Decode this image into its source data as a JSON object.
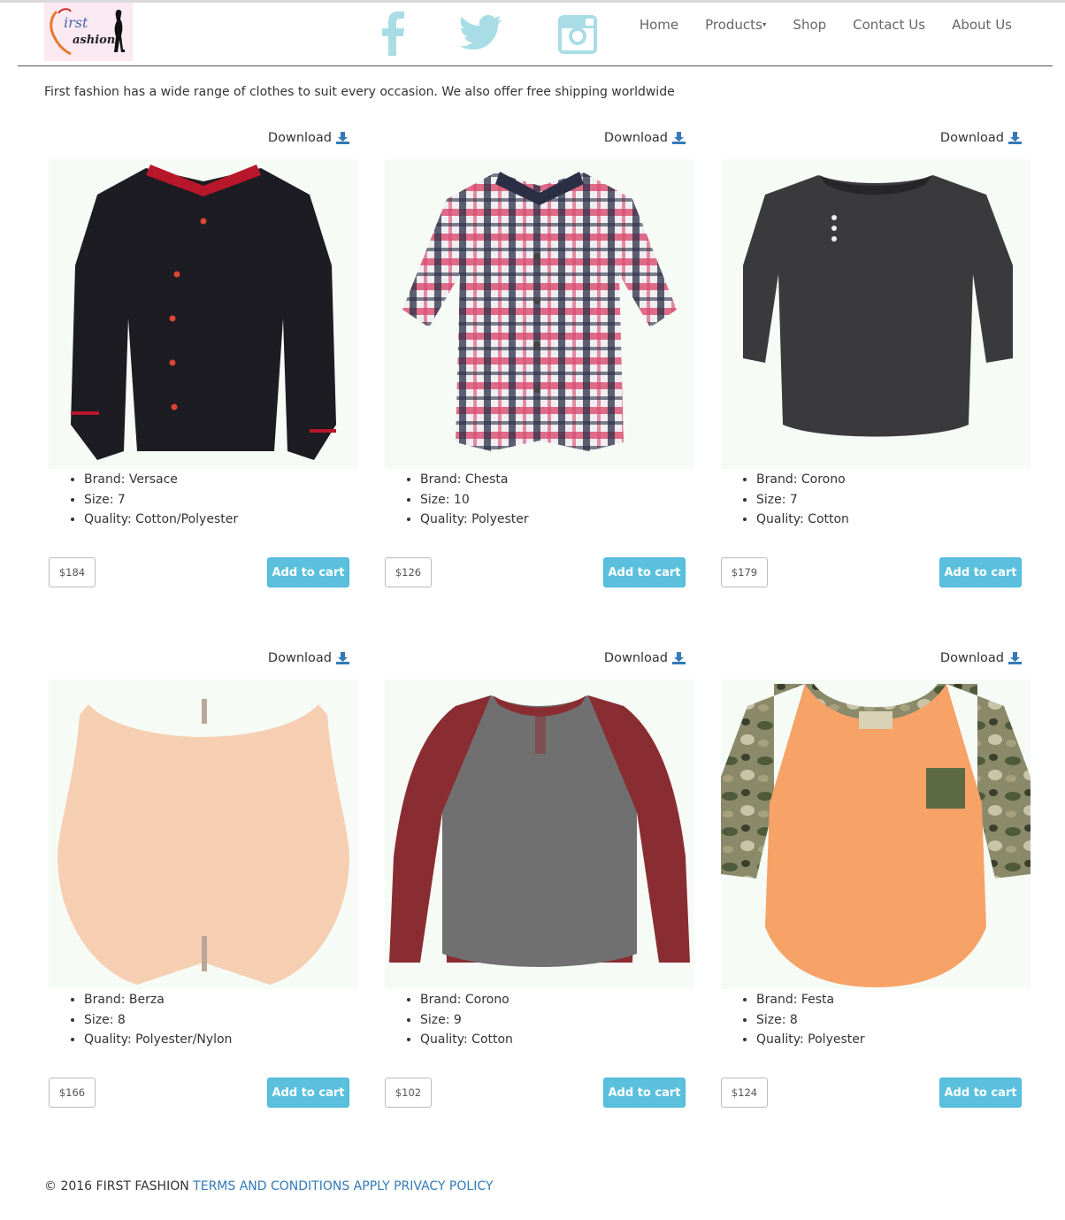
{
  "brand": {
    "logo_text_top": "irst",
    "logo_text_bottom": "ashion"
  },
  "social": [
    {
      "name": "facebook-icon"
    },
    {
      "name": "twitter-icon"
    },
    {
      "name": "instagram-icon"
    }
  ],
  "nav": {
    "home": "Home",
    "products": "Products",
    "shop": "Shop",
    "contact": "Contact Us",
    "about": "About Us"
  },
  "intro": "First fashion has a wide range of clothes to suit every occasion. We also offer free shipping worldwide",
  "labels": {
    "download": "Download",
    "add_to_cart": "Add to cart"
  },
  "products": [
    {
      "brand": "Brand: Versace",
      "size": "Size: 7",
      "quality": "Quality: Cotton/Polyester",
      "price": "$184"
    },
    {
      "brand": "Brand: Chesta",
      "size": "Size: 10",
      "quality": "Quality: Polyester",
      "price": "$126"
    },
    {
      "brand": "Brand: Corono",
      "size": "Size: 7",
      "quality": "Quality: Cotton",
      "price": "$179"
    },
    {
      "brand": "Brand: Berza",
      "size": "Size: 8",
      "quality": "Quality: Polyester/Nylon",
      "price": "$166"
    },
    {
      "brand": "Brand: Corono",
      "size": "Size: 9",
      "quality": "Quality: Cotton",
      "price": "$102"
    },
    {
      "brand": "Brand: Festa",
      "size": "Size: 8",
      "quality": "Quality: Polyester",
      "price": "$124"
    }
  ],
  "footer": {
    "copyright": "© 2016 FIRST FASHION ",
    "terms": "TERMS AND CONDITIONS APPLY",
    "privacy": "PRIVACY POLICY"
  },
  "colors": {
    "accent": "#5bc0de",
    "social": "#a9dde6",
    "link": "#337ab7"
  }
}
